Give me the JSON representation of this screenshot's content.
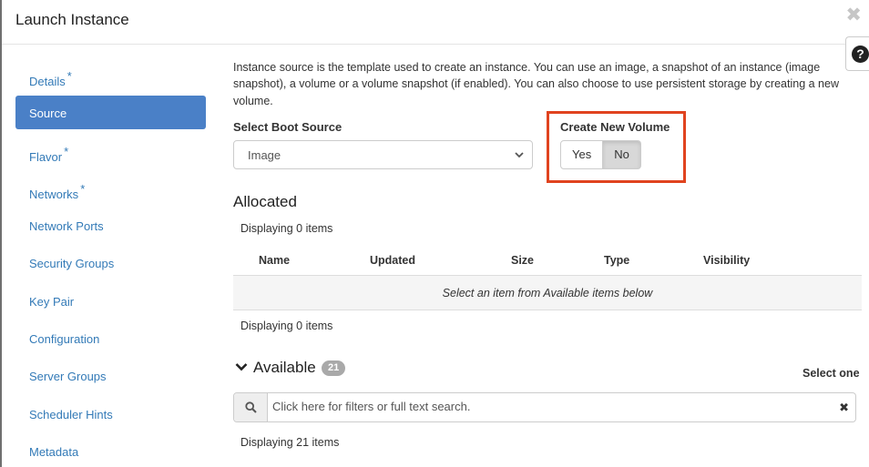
{
  "modal": {
    "title": "Launch Instance",
    "close_icon": "close-icon",
    "help_icon": "question-circle-icon",
    "help_glyph": "?",
    "close_glyph": "✖"
  },
  "sidebar": {
    "items": [
      {
        "label": "Details",
        "required": "*",
        "active": false
      },
      {
        "label": "Source",
        "required": "",
        "active": true
      },
      {
        "label": "Flavor",
        "required": "*",
        "active": false
      },
      {
        "label": "Networks",
        "required": "*",
        "active": false
      },
      {
        "label": "Network Ports",
        "required": "",
        "active": false
      },
      {
        "label": "Security Groups",
        "required": "",
        "active": false
      },
      {
        "label": "Key Pair",
        "required": "",
        "active": false
      },
      {
        "label": "Configuration",
        "required": "",
        "active": false
      },
      {
        "label": "Server Groups",
        "required": "",
        "active": false
      },
      {
        "label": "Scheduler Hints",
        "required": "",
        "active": false
      },
      {
        "label": "Metadata",
        "required": "",
        "active": false
      }
    ]
  },
  "source": {
    "description": "Instance source is the template used to create an instance. You can use an image, a snapshot of an instance (image snapshot), a volume or a volume snapshot (if enabled). You can also choose to use persistent storage by creating a new volume.",
    "boot_source_label": "Select Boot Source",
    "boot_source_value": "Image",
    "create_volume_label": "Create New Volume",
    "create_volume_yes": "Yes",
    "create_volume_no": "No",
    "create_volume_selected": "No"
  },
  "allocated": {
    "title": "Allocated",
    "displaying_top": "Displaying 0 items",
    "columns": [
      "Name",
      "Updated",
      "Size",
      "Type",
      "Visibility"
    ],
    "empty_message": "Select an item from Available items below",
    "displaying_bottom": "Displaying 0 items"
  },
  "available": {
    "title": "Available",
    "count": "21",
    "select_hint": "Select one",
    "search_placeholder": "Click here for filters or full text search.",
    "search_icon": "search-icon",
    "clear_glyph": "✖",
    "displaying": "Displaying 21 items"
  },
  "colors": {
    "accent": "#4a80c7",
    "link": "#337ab7",
    "highlight_box": "#e0431f",
    "badge": "#a9a9a9"
  }
}
